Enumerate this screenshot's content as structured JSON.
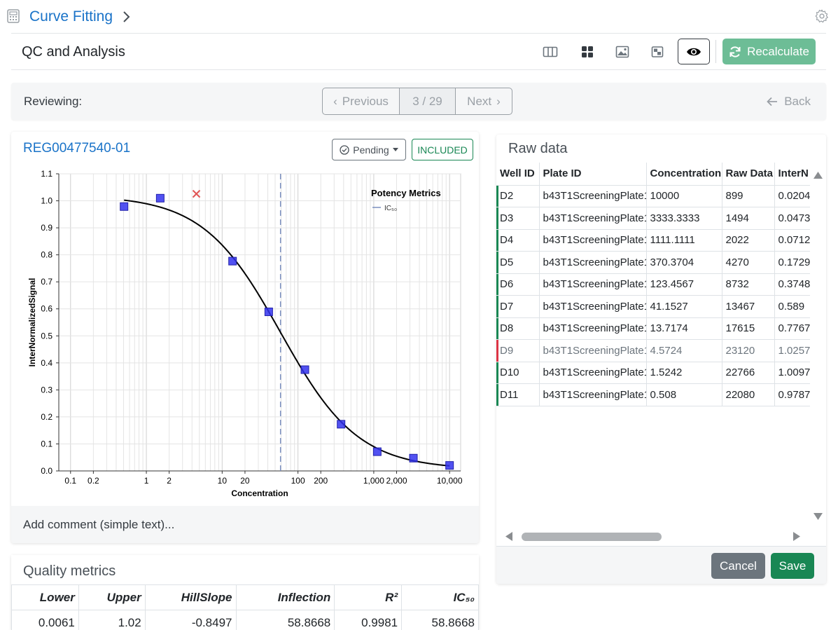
{
  "app": {
    "title": "Curve Fitting"
  },
  "toolbar": {
    "page_title": "QC and Analysis",
    "recalculate_label": "Recalculate",
    "accent_color": "#6dbd96"
  },
  "review": {
    "label": "Reviewing:",
    "previous_label": "Previous",
    "page_counter": "3 / 29",
    "next_label": "Next",
    "back_label": "Back"
  },
  "compound": {
    "id": "REG00477540-01",
    "status_label": "Pending",
    "included_label": "INCLUDED"
  },
  "chart_data": {
    "type": "scatter",
    "xlabel": "Concentration",
    "ylabel": "InterNormalizedSignal",
    "x_scale": "log",
    "xlim": [
      0.07,
      14000
    ],
    "ylim": [
      0,
      1.1
    ],
    "x_tick_labels": [
      "0.1",
      "0.2",
      "1",
      "2",
      "10",
      "20",
      "100",
      "200",
      "1,000",
      "2,000",
      "10,000"
    ],
    "x_tick_values": [
      0.1,
      0.2,
      1,
      2,
      10,
      20,
      100,
      200,
      1000,
      2000,
      10000
    ],
    "y_tick_labels": [
      "0.0",
      "0.1",
      "0.2",
      "0.3",
      "0.4",
      "0.5",
      "0.6",
      "0.7",
      "0.8",
      "0.9",
      "1.0",
      "1.1"
    ],
    "grid": true,
    "legend": {
      "title": "Potency Metrics",
      "entries": [
        "IC₅₀"
      ],
      "placement": "top-right"
    },
    "points": [
      {
        "x": 10000,
        "y": 0.0204,
        "included": true
      },
      {
        "x": 3333.3333,
        "y": 0.0473,
        "included": true
      },
      {
        "x": 1111.1111,
        "y": 0.0712,
        "included": true
      },
      {
        "x": 370.3704,
        "y": 0.1729,
        "included": true
      },
      {
        "x": 123.4567,
        "y": 0.3748,
        "included": true
      },
      {
        "x": 41.1527,
        "y": 0.589,
        "included": true
      },
      {
        "x": 13.7174,
        "y": 0.7767,
        "included": true
      },
      {
        "x": 4.5724,
        "y": 1.0257,
        "included": false
      },
      {
        "x": 1.5242,
        "y": 1.0097,
        "included": true
      },
      {
        "x": 0.508,
        "y": 0.9787,
        "included": true
      }
    ],
    "fit": {
      "lower": 0.0061,
      "upper": 1.02,
      "hill_slope": -0.8497,
      "inflection": 58.8668
    },
    "ic50_line": 58.8668,
    "colors": {
      "included_point": "#3333ee",
      "excluded_point": "#e05555",
      "fit_line": "#000000",
      "ic50_line": "#7a8fbf"
    }
  },
  "comment": {
    "placeholder": "Add comment (simple text)..."
  },
  "quality_metrics": {
    "title": "Quality metrics",
    "headers": [
      "Lower",
      "Upper",
      "HillSlope",
      "Inflection",
      "R²",
      "IC₅₀"
    ],
    "values": [
      "0.0061",
      "1.02",
      "-0.8497",
      "58.8668",
      "0.9981",
      "58.8668"
    ]
  },
  "raw_data": {
    "title": "Raw data",
    "headers": [
      "Well ID",
      "Plate ID",
      "Concentration",
      "Raw Data",
      "InterN"
    ],
    "rows": [
      {
        "well": "D2",
        "plate": "b43T1ScreeningPlate1",
        "conc": "10000",
        "raw": "899",
        "norm": "0.0204",
        "status": "ok"
      },
      {
        "well": "D3",
        "plate": "b43T1ScreeningPlate1",
        "conc": "3333.3333",
        "raw": "1494",
        "norm": "0.0473",
        "status": "ok"
      },
      {
        "well": "D4",
        "plate": "b43T1ScreeningPlate1",
        "conc": "1111.1111",
        "raw": "2022",
        "norm": "0.0712",
        "status": "ok"
      },
      {
        "well": "D5",
        "plate": "b43T1ScreeningPlate1",
        "conc": "370.3704",
        "raw": "4270",
        "norm": "0.1729",
        "status": "ok"
      },
      {
        "well": "D6",
        "plate": "b43T1ScreeningPlate1",
        "conc": "123.4567",
        "raw": "8732",
        "norm": "0.3748",
        "status": "ok"
      },
      {
        "well": "D7",
        "plate": "b43T1ScreeningPlate1",
        "conc": "41.1527",
        "raw": "13467",
        "norm": "0.589",
        "status": "ok"
      },
      {
        "well": "D8",
        "plate": "b43T1ScreeningPlate1",
        "conc": "13.7174",
        "raw": "17615",
        "norm": "0.7767",
        "status": "ok"
      },
      {
        "well": "D9",
        "plate": "b43T1ScreeningPlate1",
        "conc": "4.5724",
        "raw": "23120",
        "norm": "1.0257",
        "status": "excl"
      },
      {
        "well": "D10",
        "plate": "b43T1ScreeningPlate1",
        "conc": "1.5242",
        "raw": "22766",
        "norm": "1.0097",
        "status": "ok"
      },
      {
        "well": "D11",
        "plate": "b43T1ScreeningPlate1",
        "conc": "0.508",
        "raw": "22080",
        "norm": "0.9787",
        "status": "ok"
      }
    ],
    "cancel_label": "Cancel",
    "save_label": "Save"
  }
}
